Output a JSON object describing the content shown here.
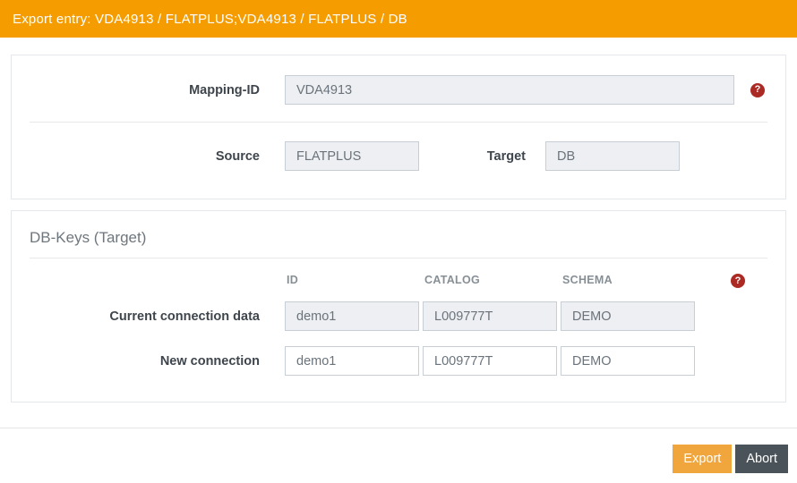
{
  "header": {
    "title": "Export entry: VDA4913 / FLATPLUS;VDA4913 / FLATPLUS / DB"
  },
  "mapping_section": {
    "mapping_id": {
      "label": "Mapping-ID",
      "value": "VDA4913"
    },
    "source": {
      "label": "Source",
      "value": "FLATPLUS"
    },
    "target": {
      "label": "Target",
      "value": "DB"
    }
  },
  "db_keys_section": {
    "title": "DB-Keys (Target)",
    "columns": [
      "ID",
      "CATALOG",
      "SCHEMA"
    ],
    "rows": [
      {
        "label": "Current connection data",
        "id": "demo1",
        "catalog": "L009777T",
        "schema": "DEMO"
      },
      {
        "label": "New connection",
        "id": "demo1",
        "catalog": "L009777T",
        "schema": "DEMO"
      }
    ]
  },
  "icons": {
    "help": "?"
  },
  "footer": {
    "export_label": "Export",
    "abort_label": "Abort"
  },
  "colors": {
    "header_bg": "#F59C00",
    "export_button": "#F0A63C",
    "abort_button": "#4A525A",
    "help_icon": "#AB2B24",
    "disabled_input_bg": "#EDEFF2",
    "input_border": "#C8CED6",
    "card_border": "#E4E8EC"
  }
}
